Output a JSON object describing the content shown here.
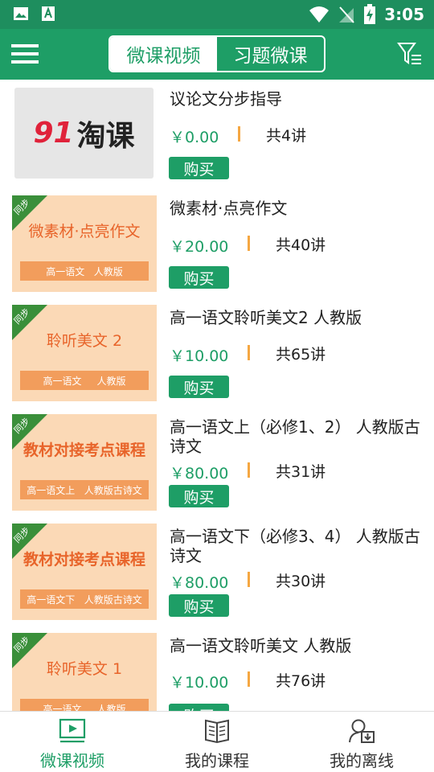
{
  "status_bar": {
    "time": "3:05",
    "icons": [
      "gallery-icon",
      "text-a-icon",
      "wifi-icon",
      "no-signal-icon",
      "battery-charging-icon"
    ]
  },
  "app_bar": {
    "menu_icon": "hamburger-menu-icon",
    "filter_icon": "filter-icon",
    "tabs": [
      {
        "label": "微课视频",
        "active": true
      },
      {
        "label": "习题微课",
        "active": false
      }
    ]
  },
  "colors": {
    "primary": "#1e9e66",
    "thumb_bg": "#fbd9b6",
    "thumb_title": "#e8642a",
    "separator": "#f5a742"
  },
  "courses": [
    {
      "title": "议论文分步指导",
      "price": "￥0.00",
      "count": "共4讲",
      "buy_label": "购买",
      "thumb": {
        "type": "logo",
        "logo_num": "91",
        "logo_text": "淘课"
      }
    },
    {
      "title": "微素材·点亮作文",
      "price": "￥20.00",
      "count": "共40讲",
      "buy_label": "购买",
      "thumb": {
        "type": "poster",
        "badge": "同步",
        "title": "微素材·点亮作文",
        "band": "高一语文   人教版"
      }
    },
    {
      "title": "高一语文聆听美文2 人教版",
      "price": "￥10.00",
      "count": "共65讲",
      "buy_label": "购买",
      "thumb": {
        "type": "poster",
        "badge": "同步",
        "title": "聆听美文 2",
        "band": "高一语文     人教版"
      }
    },
    {
      "title": "高一语文上（必修1、2） 人教版古诗文",
      "price": "￥80.00",
      "count": "共31讲",
      "buy_label": "购买",
      "thumb": {
        "type": "poster",
        "badge": "同步",
        "title": "教材对接考点课程",
        "band": "高一语文上   人教版古诗文"
      }
    },
    {
      "title": "高一语文下（必修3、4） 人教版古诗文",
      "price": "￥80.00",
      "count": "共30讲",
      "buy_label": "购买",
      "thumb": {
        "type": "poster",
        "badge": "同步",
        "title": "教材对接考点课程",
        "band": "高一语文下   人教版古诗文"
      }
    },
    {
      "title": "高一语文聆听美文 人教版",
      "price": "￥10.00",
      "count": "共76讲",
      "buy_label": "购买",
      "thumb": {
        "type": "poster",
        "badge": "同步",
        "title": "聆听美文 1",
        "band": "高一语文     人教版"
      }
    }
  ],
  "bottom_nav": [
    {
      "label": "微课视频",
      "icon": "video-play-icon",
      "active": true
    },
    {
      "label": "我的课程",
      "icon": "open-book-icon",
      "active": false
    },
    {
      "label": "我的离线",
      "icon": "user-download-icon",
      "active": false
    }
  ]
}
